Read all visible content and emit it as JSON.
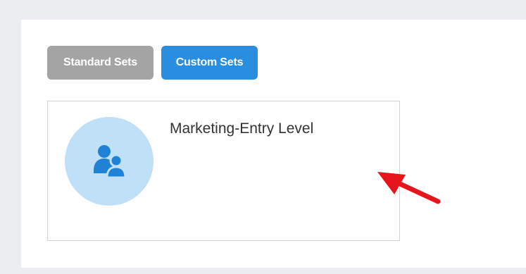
{
  "tabs": {
    "standard_label": "Standard Sets",
    "custom_label": "Custom Sets",
    "active": "custom"
  },
  "card": {
    "title": "Marketing-Entry Level",
    "icon": "user-group-icon"
  },
  "annotation": {
    "icon": "red-arrow-pointer"
  },
  "colors": {
    "background": "#ebedf0",
    "panel": "#ffffff",
    "tab_inactive": "#a4a4a4",
    "tab_active": "#2a8ee0",
    "avatar_bg": "#bfe0f6",
    "avatar_icon": "#1f82d6",
    "arrow": "#e8141b"
  }
}
